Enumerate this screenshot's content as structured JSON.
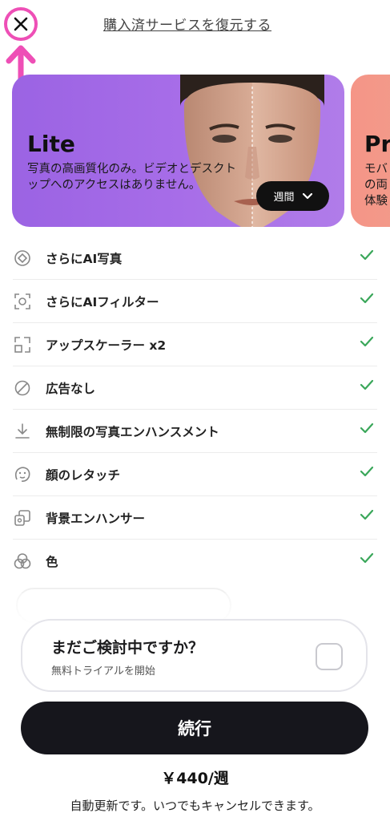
{
  "header": {
    "close_icon": "close-icon",
    "restore_link": "購入済サービスを復元する",
    "accent_color": "#ee4fb6"
  },
  "plans": [
    {
      "name": "Lite",
      "description": "写真の高画質化のみ。ビデオとデスクトップへのアクセスはありません。",
      "period_label": "週間",
      "background": "#a26ae6"
    },
    {
      "name": "Pro",
      "description": "モバ\nの両\n体験",
      "background": "#f4968a"
    }
  ],
  "features": [
    {
      "icon": "ai-photo-icon",
      "label": "さらにAI写真"
    },
    {
      "icon": "ai-filter-icon",
      "label": "さらにAIフィルター"
    },
    {
      "icon": "upscale-icon",
      "label": "アップスケーラー x2"
    },
    {
      "icon": "no-ads-icon",
      "label": "広告なし"
    },
    {
      "icon": "download-icon",
      "label": "無制限の写真エンハンスメント"
    },
    {
      "icon": "face-retouch-icon",
      "label": "顔のレタッチ"
    },
    {
      "icon": "background-icon",
      "label": "背景エンハンサー"
    },
    {
      "icon": "color-icon",
      "label": "色"
    }
  ],
  "check_color": "#3aa75a",
  "trial": {
    "title": "まだご検討中ですか？",
    "subtitle": "無料トライアルを開始"
  },
  "cta": {
    "continue_label": "続行",
    "price": "￥440/週",
    "footnote": "自動更新です。いつでもキャンセルできます。"
  }
}
